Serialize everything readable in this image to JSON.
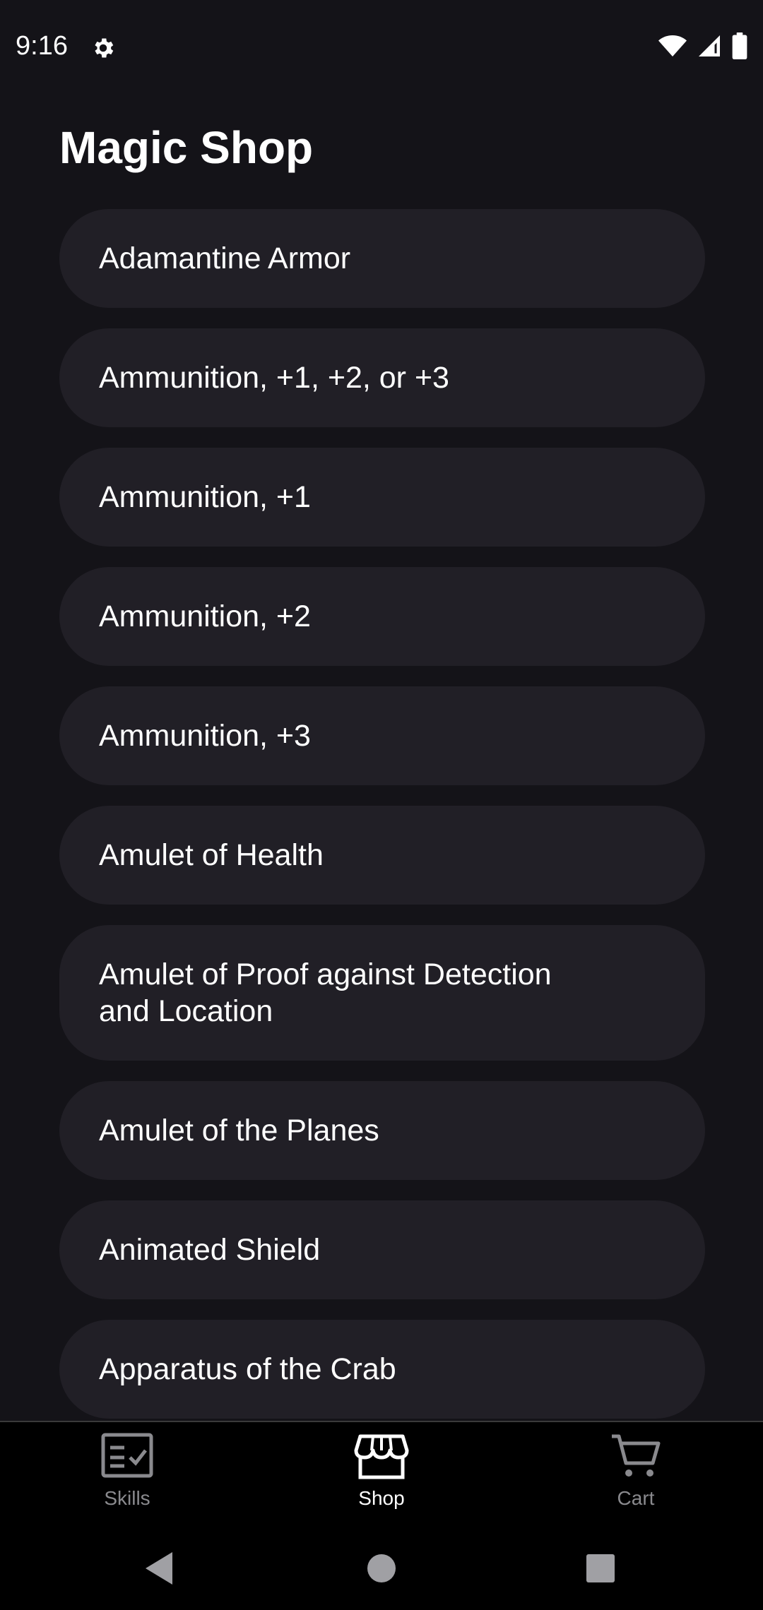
{
  "status_bar": {
    "time": "9:16",
    "icons": [
      "gear-icon",
      "wifi-icon",
      "signal-icon",
      "battery-icon"
    ]
  },
  "page": {
    "title": "Magic Shop"
  },
  "items": [
    {
      "label": "Adamantine Armor"
    },
    {
      "label": "Ammunition, +1, +2, or +3"
    },
    {
      "label": "Ammunition, +1"
    },
    {
      "label": "Ammunition, +2"
    },
    {
      "label": "Ammunition, +3"
    },
    {
      "label": "Amulet of Health"
    },
    {
      "label": "Amulet of Proof against Detection and Location"
    },
    {
      "label": "Amulet of the Planes"
    },
    {
      "label": "Animated Shield"
    },
    {
      "label": "Apparatus of the Crab"
    }
  ],
  "bottom_nav": {
    "skills": {
      "label": "Skills",
      "icon": "checklist-icon"
    },
    "shop": {
      "label": "Shop",
      "icon": "store-icon",
      "active": true
    },
    "cart": {
      "label": "Cart",
      "icon": "cart-icon"
    }
  },
  "system_nav": [
    "back-icon",
    "home-icon",
    "recents-icon"
  ],
  "colors": {
    "background": "#141318",
    "card": "#211f26",
    "text": "#ffffff",
    "inactive": "#8a8a8e"
  }
}
